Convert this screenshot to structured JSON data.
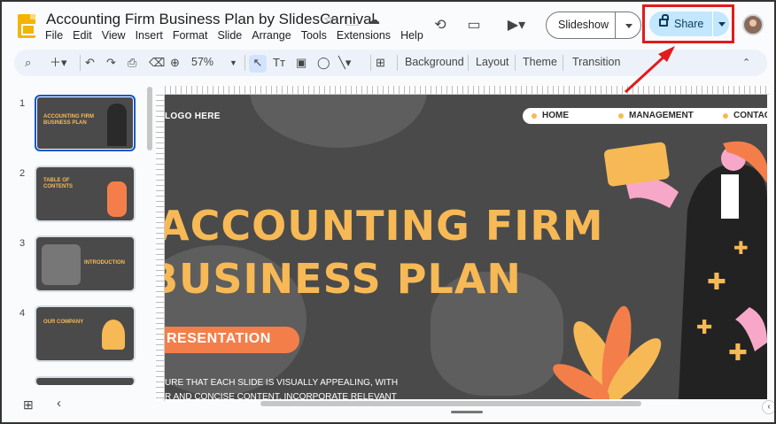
{
  "app": {
    "title": "Accounting Firm Business Plan by SlidesCarnival"
  },
  "menu": [
    "File",
    "Edit",
    "View",
    "Insert",
    "Format",
    "Slide",
    "Arrange",
    "Tools",
    "Extensions",
    "Help"
  ],
  "header": {
    "slideshow_label": "Slideshow",
    "share_label": "Share"
  },
  "toolbar": {
    "zoom": "57%",
    "background": "Background",
    "layout": "Layout",
    "theme": "Theme",
    "transition": "Transition"
  },
  "slides": [
    {
      "num": "1",
      "thumb_text": "ACCOUNTING FIRM BUSINESS PLAN",
      "selected": true
    },
    {
      "num": "2",
      "thumb_text": "TABLE OF CONTENTS"
    },
    {
      "num": "3",
      "thumb_text": "INTRODUCTION"
    },
    {
      "num": "4",
      "thumb_text": "OUR COMPANY"
    }
  ],
  "slide": {
    "logo": "LOGO HERE",
    "nav": [
      "HOME",
      "MANAGEMENT",
      "CONTAC"
    ],
    "title_line1": "ACCOUNTING FIRM",
    "title_line2": "BUSINESS PLAN",
    "pill": "RESENTATION",
    "body_line1": "URE THAT EACH SLIDE IS VISUALLY APPEALING, WITH",
    "body_line2": "R AND CONCISE CONTENT. INCORPORATE RELEVANT"
  },
  "colors": {
    "accent": "#f7b955",
    "orange": "#f47e4a",
    "slide_bg": "#4a4a4a",
    "share_bg": "#c2e7ff",
    "highlight": "#e21b1b"
  }
}
